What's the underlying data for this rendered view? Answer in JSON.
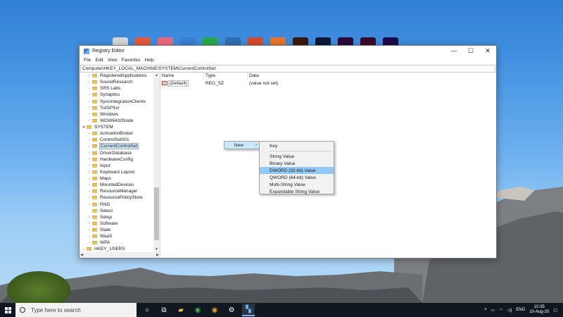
{
  "window": {
    "title": "Registry Editor",
    "controls": {
      "minimize": "—",
      "maximize": "☐",
      "close": "✕"
    }
  },
  "menu": [
    "File",
    "Edit",
    "View",
    "Favorites",
    "Help"
  ],
  "address": "Computer\\HKEY_LOCAL_MACHINE\\SYSTEM\\CurrentControlSet",
  "tree": [
    {
      "label": "RegisteredApplications",
      "level": 1
    },
    {
      "label": "SoundResearch",
      "level": 1
    },
    {
      "label": "SRS Labs",
      "level": 1
    },
    {
      "label": "Synaptics",
      "level": 1
    },
    {
      "label": "SyncIntegrationClients",
      "level": 1
    },
    {
      "label": "TrdSPSvr",
      "level": 1
    },
    {
      "label": "Windows",
      "level": 1
    },
    {
      "label": "WOW6432Node",
      "level": 1
    },
    {
      "label": "SYSTEM",
      "level": 0,
      "expanded": true
    },
    {
      "label": "ActivationBroker",
      "level": 1
    },
    {
      "label": "ControlSet001",
      "level": 1
    },
    {
      "label": "CurrentControlSet",
      "level": 1,
      "selected": true
    },
    {
      "label": "DriverDatabase",
      "level": 1
    },
    {
      "label": "HardwareConfig",
      "level": 1
    },
    {
      "label": "Input",
      "level": 1
    },
    {
      "label": "Keyboard Layout",
      "level": 1
    },
    {
      "label": "Maps",
      "level": 1
    },
    {
      "label": "MountedDevices",
      "level": 1
    },
    {
      "label": "ResourceManager",
      "level": 1
    },
    {
      "label": "ResourcePolicyStore",
      "level": 1
    },
    {
      "label": "RNG",
      "level": 1
    },
    {
      "label": "Select",
      "level": 1,
      "noarrow": true
    },
    {
      "label": "Setup",
      "level": 1
    },
    {
      "label": "Software",
      "level": 1
    },
    {
      "label": "State",
      "level": 1
    },
    {
      "label": "WaaS",
      "level": 1
    },
    {
      "label": "WPA",
      "level": 1
    },
    {
      "label": "HKEY_USERS",
      "level": 0
    }
  ],
  "columns": {
    "name": "Name",
    "type": "Type",
    "data": "Data"
  },
  "values": [
    {
      "icon": "ab",
      "name": "(Default)",
      "type": "REG_SZ",
      "data": "(value not set)"
    }
  ],
  "context_menu": {
    "new_label": "New",
    "submenu": {
      "key": "Key",
      "items": [
        "String Value",
        "Binary Value",
        "DWORD (32-bit) Value",
        "QWORD (64-bit) Value",
        "Multi-String Value",
        "Expandable String Value"
      ],
      "highlighted_index": 2
    }
  },
  "taskbar": {
    "search_placeholder": "Type here to search",
    "language": "ENG",
    "time": "10:35",
    "date": "10-Aug-20"
  },
  "colors": {
    "selection": "#cce8ff",
    "menu_highlight": "#91c9f7",
    "taskbar": "#10181f"
  }
}
